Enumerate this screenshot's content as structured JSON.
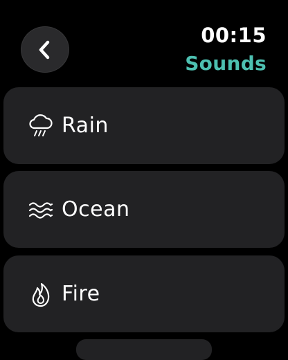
{
  "header": {
    "time": "00:15",
    "title": "Sounds"
  },
  "sounds": [
    {
      "label": "Rain",
      "icon": "cloud-rain-icon"
    },
    {
      "label": "Ocean",
      "icon": "waves-icon"
    },
    {
      "label": "Fire",
      "icon": "flame-icon"
    }
  ],
  "colors": {
    "accent": "#4dc0b1",
    "background": "#000000",
    "card": "#222224"
  }
}
